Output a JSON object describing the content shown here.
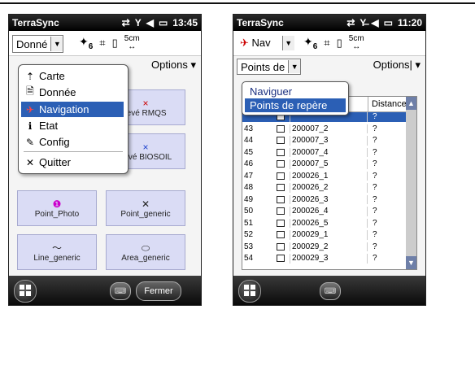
{
  "colors": {
    "accent": "#2b5fb5",
    "button_bg": "#dadcf5",
    "title_bar": "#000000",
    "nav_red": "#cc0000"
  },
  "screen1": {
    "title": "TerraSync",
    "time": "13:45",
    "dropdown_label": "Donné",
    "sat_count": "6",
    "unit": "5cm",
    "options_label": "Options",
    "menu": [
      {
        "label": "Carte",
        "icon": "carte-icon",
        "glyph": "⇡"
      },
      {
        "label": "Donnée",
        "icon": "document-icon",
        "glyph": "🗎"
      },
      {
        "label": "Navigation",
        "icon": "navigation-icon",
        "glyph": "✈"
      },
      {
        "label": "Etat",
        "icon": "info-icon",
        "glyph": "ℹ"
      },
      {
        "label": "Config",
        "icon": "wrench-icon",
        "glyph": "✎"
      },
      {
        "label": "Quitter",
        "icon": "close-icon",
        "glyph": "✕"
      }
    ],
    "buttons": [
      {
        "label": "levé RMQS",
        "glyph": "×",
        "color": "#cc0000"
      },
      {
        "label": "Levé BIOSOIL",
        "glyph": "×",
        "color": "#1a3fcc"
      },
      {
        "label": "Point_Photo",
        "glyph": "❶",
        "color": "#cc00cc"
      },
      {
        "label": "Point_generic",
        "glyph": "✕",
        "color": "#222222"
      },
      {
        "label": "Line_generic",
        "glyph": "〜",
        "color": "#222222"
      },
      {
        "label": "Area_generic",
        "glyph": "⬭",
        "color": "#222222"
      }
    ],
    "close_label": "Fermer"
  },
  "screen2": {
    "title": "TerraSync",
    "time": "11:20",
    "nav_label": "Nav",
    "sat_count": "6",
    "unit": "5cm",
    "points_label": "Points de",
    "options_label": "Options",
    "popup": [
      {
        "label": "Naviguer"
      },
      {
        "label": "Points de repère"
      }
    ],
    "column_distance": "Distance",
    "rows": [
      {
        "num": "",
        "name": "",
        "dist": "?"
      },
      {
        "num": "43",
        "name": "200007_2",
        "dist": "?"
      },
      {
        "num": "44",
        "name": "200007_3",
        "dist": "?"
      },
      {
        "num": "45",
        "name": "200007_4",
        "dist": "?"
      },
      {
        "num": "46",
        "name": "200007_5",
        "dist": "?"
      },
      {
        "num": "47",
        "name": "200026_1",
        "dist": "?"
      },
      {
        "num": "48",
        "name": "200026_2",
        "dist": "?"
      },
      {
        "num": "49",
        "name": "200026_3",
        "dist": "?"
      },
      {
        "num": "50",
        "name": "200026_4",
        "dist": "?"
      },
      {
        "num": "51",
        "name": "200026_5",
        "dist": "?"
      },
      {
        "num": "52",
        "name": "200029_1",
        "dist": "?"
      },
      {
        "num": "53",
        "name": "200029_2",
        "dist": "?"
      },
      {
        "num": "54",
        "name": "200029_3",
        "dist": "?"
      }
    ]
  }
}
